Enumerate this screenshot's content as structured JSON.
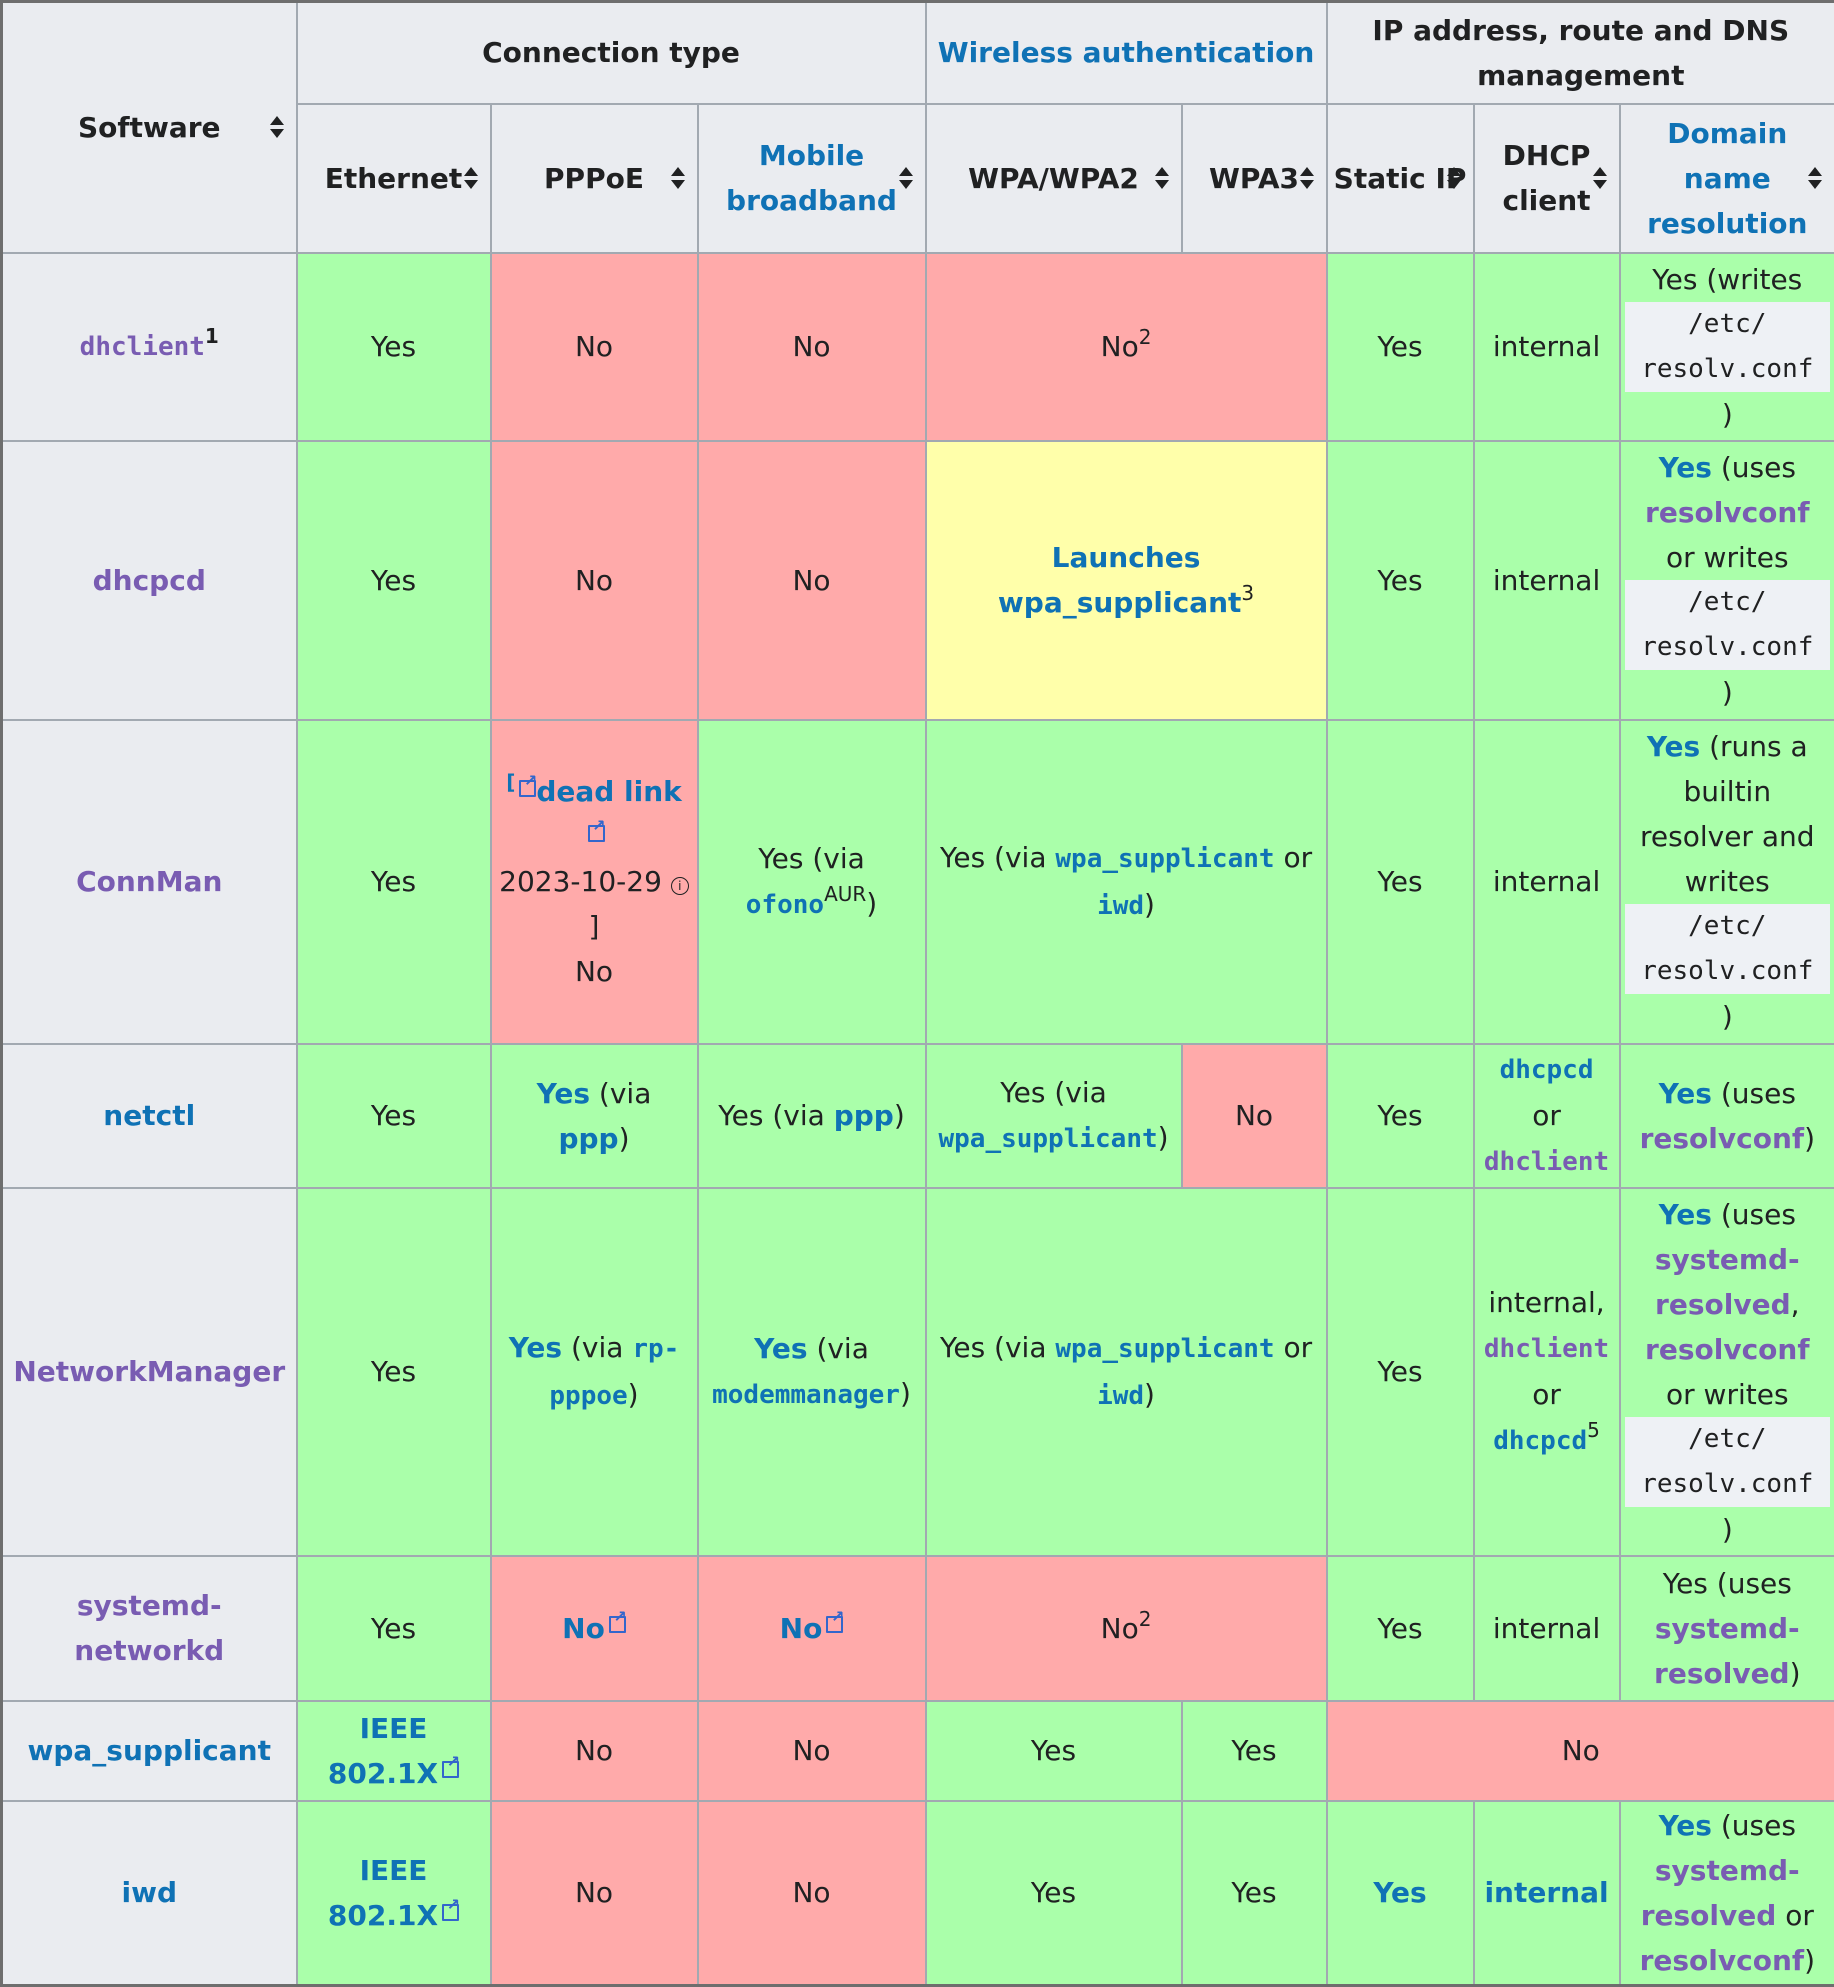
{
  "colors": {
    "header_bg": "#eaecf0",
    "yes_bg": "#aaffaa",
    "no_bg": "#ffaaaa",
    "partial_bg": "#ffffaa",
    "link": "#0f72b5",
    "visited_link": "#795cb2",
    "text": "#202122",
    "border": "#a2a9b1"
  },
  "header": {
    "software": "Software",
    "groups": {
      "connection_type": "Connection type",
      "wireless_auth": "Wireless authentication",
      "ip_mgmt": "IP address, route and DNS management"
    },
    "columns": {
      "ethernet": "Ethernet",
      "pppoe": "PPPoE",
      "mobile_broadband": "Mobile broadband",
      "wpa": "WPA/WPA2",
      "wpa3": "WPA3",
      "static_ip": "Static IP",
      "dhcp_client": "DHCP client",
      "dns": "Domain name resolution"
    }
  },
  "rows": [
    {
      "software": {
        "text": "dhclient",
        "sup": "1"
      },
      "ethernet": "Yes",
      "pppoe": "No",
      "mobile": "No",
      "wireless": {
        "text": "No",
        "sup": "2"
      },
      "static_ip": "Yes",
      "dhcp": "internal",
      "dns": {
        "pre": "Yes (writes",
        "code": "/etc/ resolv.conf",
        "post": ")"
      }
    },
    {
      "software": {
        "text": "dhcpcd"
      },
      "ethernet": "Yes",
      "pppoe": "No",
      "mobile": "No",
      "wireless": {
        "link": "Launches wpa_supplicant",
        "sup": "3"
      },
      "static_ip": "Yes",
      "dhcp": "internal",
      "dns": {
        "yes": "Yes",
        "t1": "(uses",
        "l1": "resolvconf",
        "t2": "or writes",
        "code": "/etc/ resolv.conf",
        "post": ")"
      }
    },
    {
      "software": {
        "text": "ConnMan"
      },
      "ethernet": "Yes",
      "pppoe": {
        "bracket_open": "[",
        "dead_link": "dead link",
        "date": "2023-10-29",
        "info": "ⓘ",
        "bracket_close": "]",
        "value": "No"
      },
      "mobile": {
        "pre": "Yes (via",
        "code": "ofono",
        "sup": "AUR",
        "post": ")"
      },
      "wireless": {
        "pre": "Yes (via",
        "code1": "wpa_supplicant",
        "mid": "or",
        "code2": "iwd",
        "post": ")"
      },
      "static_ip": "Yes",
      "dhcp": "internal",
      "dns": {
        "yes": "Yes",
        "t1": "(runs a builtin resolver and writes",
        "code": "/etc/ resolv.conf",
        "post": ")"
      }
    },
    {
      "software": {
        "text": "netctl"
      },
      "ethernet": "Yes",
      "pppoe": {
        "yes": "Yes",
        "pre": "(via",
        "link": "ppp",
        "post": ")"
      },
      "mobile": {
        "pre": "Yes (via",
        "link": "ppp",
        "post": ")"
      },
      "wpa": {
        "pre": "Yes (via",
        "code": "wpa_supplicant",
        "post": ")"
      },
      "wpa3": "No",
      "static_ip": "Yes",
      "dhcp": {
        "code1": "dhcpcd",
        "mid": "or",
        "code2": "dhclient"
      },
      "dns": {
        "yes": "Yes",
        "t1": "(uses",
        "l1": "resolvconf",
        "post": ")"
      }
    },
    {
      "software": {
        "text": "NetworkManager"
      },
      "ethernet": "Yes",
      "pppoe": {
        "yes": "Yes",
        "pre": "(via",
        "code": "rp-pppoe",
        "post": ")"
      },
      "mobile": {
        "yes": "Yes",
        "pre": "(via",
        "code": "modemmanager",
        "post": ")"
      },
      "wireless": {
        "pre": "Yes (via",
        "code1": "wpa_supplicant",
        "mid": "or",
        "code2": "iwd",
        "post": ")"
      },
      "static_ip": "Yes",
      "dhcp": {
        "pre": "internal,",
        "code1": "dhclient",
        "mid": "or",
        "code2": "dhcpcd",
        "sup": "5"
      },
      "dns": {
        "yes": "Yes",
        "t1": "(uses",
        "l1": "systemd-resolved",
        "c1": ",",
        "l2": "resolvconf",
        "t2": "or writes",
        "code": "/etc/ resolv.conf",
        "post": ")"
      }
    },
    {
      "software": {
        "text": "systemd-networkd"
      },
      "ethernet": "Yes",
      "pppoe": {
        "link": "No"
      },
      "mobile": {
        "link": "No"
      },
      "wireless": {
        "text": "No",
        "sup": "2"
      },
      "static_ip": "Yes",
      "dhcp": "internal",
      "dns": {
        "pre": "Yes (uses",
        "l1": "systemd-resolved",
        "post": ")"
      }
    },
    {
      "software": {
        "text": "wpa_supplicant"
      },
      "ethernet": {
        "link": "IEEE 802.1X"
      },
      "pppoe": "No",
      "mobile": "No",
      "wpa": "Yes",
      "wpa3": "Yes",
      "ip_mgmt": "No"
    },
    {
      "software": {
        "text": "iwd"
      },
      "ethernet": {
        "link": "IEEE 802.1X"
      },
      "pppoe": "No",
      "mobile": "No",
      "wpa": "Yes",
      "wpa3": "Yes",
      "static_ip": "Yes",
      "dhcp": "internal",
      "dns": {
        "yes": "Yes",
        "t1": "(uses",
        "l1": "systemd-resolved",
        "t2": "or",
        "l2": "resolvconf",
        "post": ")"
      }
    }
  ]
}
